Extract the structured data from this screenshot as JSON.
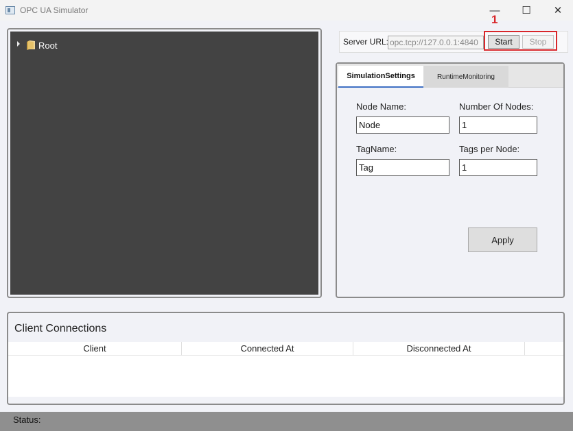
{
  "window": {
    "title": "OPC UA Simulator",
    "minimize_glyph": "—",
    "maximize_glyph": "☐",
    "close_glyph": "✕"
  },
  "tree": {
    "root_label": "Root",
    "root_icon": "folder-icon"
  },
  "server": {
    "url_label": "Server URL:",
    "url_value": "opc.tcp://127.0.0.1:4840",
    "start_label": "Start",
    "stop_label": "Stop"
  },
  "annotation": {
    "number": "1",
    "color": "#d8262a"
  },
  "tabs": [
    {
      "label": "SimulationSettings",
      "active": true
    },
    {
      "label": "RuntimeMonitoring",
      "active": false
    }
  ],
  "settings": {
    "node_name_label": "Node Name:",
    "node_name_value": "Node",
    "number_of_nodes_label": "Number Of Nodes:",
    "number_of_nodes_value": "1",
    "tag_name_label": "TagName:",
    "tag_name_value": "Tag",
    "tags_per_node_label": "Tags per Node:",
    "tags_per_node_value": "1",
    "apply_label": "Apply"
  },
  "clients": {
    "title": "Client Connections",
    "columns": [
      "Client",
      "Connected At",
      "Disconnected At"
    ],
    "rows": []
  },
  "status": {
    "label": "Status:"
  },
  "colors": {
    "tree_background": "#434343",
    "active_tab_underline": "#3e6fc4",
    "status_bar": "#8f8f8f"
  }
}
